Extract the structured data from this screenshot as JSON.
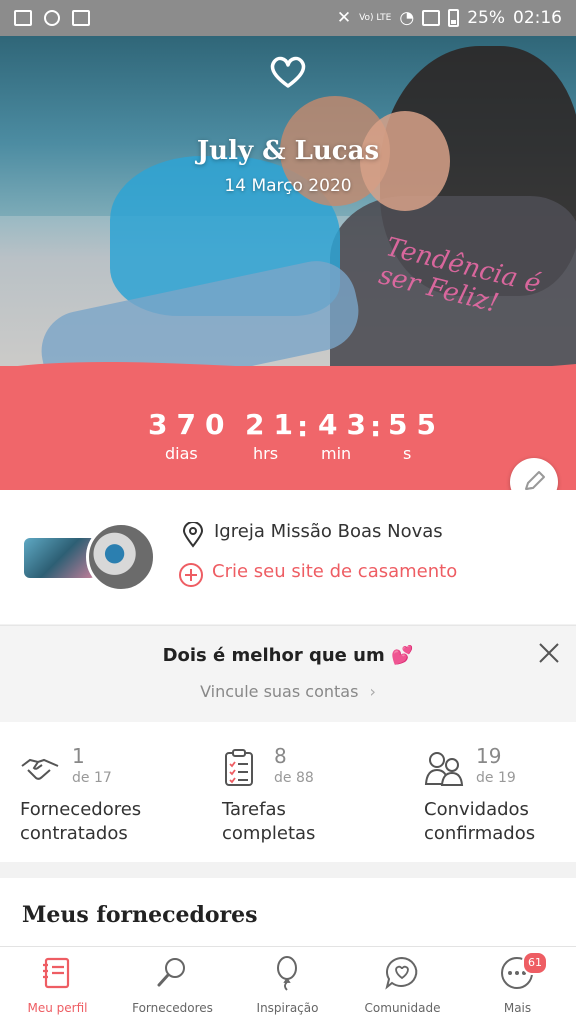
{
  "status_bar": {
    "battery": "25%",
    "time": "02:16",
    "network": "Vo) LTE"
  },
  "hero": {
    "names": "July & Lucas",
    "date": "14 Março 2020",
    "photo_text": "Tendência é ser Feliz!"
  },
  "countdown": {
    "days": "370",
    "hours": "21",
    "minutes": "43",
    "seconds": "55",
    "days_label": "dias",
    "hours_label": "hrs",
    "minutes_label": "min",
    "seconds_label": "s",
    "accent": "#f0666a"
  },
  "profile": {
    "venue": "Igreja Missão Boas Novas",
    "site_cta": "Crie seu site de casamento"
  },
  "promo": {
    "title": "Dois é melhor que um",
    "link": "Vincule suas contas"
  },
  "stats": [
    {
      "icon": "handshake-icon",
      "value": "1",
      "total": "de 17",
      "label_line1": "Fornecedores",
      "label_line2": "contratados"
    },
    {
      "icon": "clipboard-checklist-icon",
      "value": "8",
      "total": "de 88",
      "label_line1": "Tarefas",
      "label_line2": "completas"
    },
    {
      "icon": "guests-icon",
      "value": "19",
      "total": "de 19",
      "label_line1": "Convidados",
      "label_line2": "confirmados"
    }
  ],
  "vendors": {
    "title": "Meus fornecedores"
  },
  "bottom_nav": {
    "items": [
      {
        "label": "Meu perfil",
        "icon": "notebook-icon",
        "active": true
      },
      {
        "label": "Fornecedores",
        "icon": "magnifier-icon"
      },
      {
        "label": "Inspiração",
        "icon": "balloon-icon"
      },
      {
        "label": "Comunidade",
        "icon": "chat-heart-icon"
      },
      {
        "label": "Mais",
        "icon": "more-dots-icon",
        "badge": "61"
      }
    ]
  }
}
